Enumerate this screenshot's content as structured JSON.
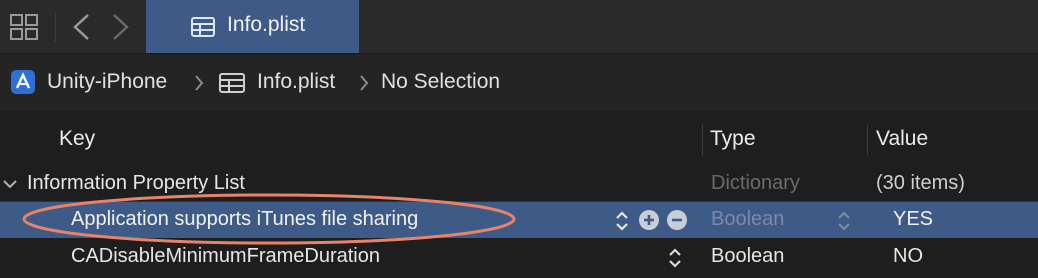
{
  "tab": {
    "label": "Info.plist",
    "icon": "table-icon"
  },
  "toolbar": {
    "grid_icon": "grid-icon",
    "back_icon": "chevron-left-icon",
    "forward_icon": "chevron-right-icon"
  },
  "jumpbar": {
    "project": "Unity-iPhone",
    "file": "Info.plist",
    "selection": "No Selection"
  },
  "columns": {
    "key": "Key",
    "type": "Type",
    "value": "Value"
  },
  "rows": [
    {
      "key": "Information Property List",
      "type": "Dictionary",
      "value": "(30 items)",
      "expanded": true
    },
    {
      "key": "Application supports iTunes file sharing",
      "type": "Boolean",
      "value": "YES",
      "selected": true
    },
    {
      "key": "CADisableMinimumFrameDuration",
      "type": "Boolean",
      "value": "NO"
    }
  ],
  "colors": {
    "selection": "#3e5a86",
    "annotation": "#e8836a",
    "project_icon": "#2f6fd6"
  }
}
